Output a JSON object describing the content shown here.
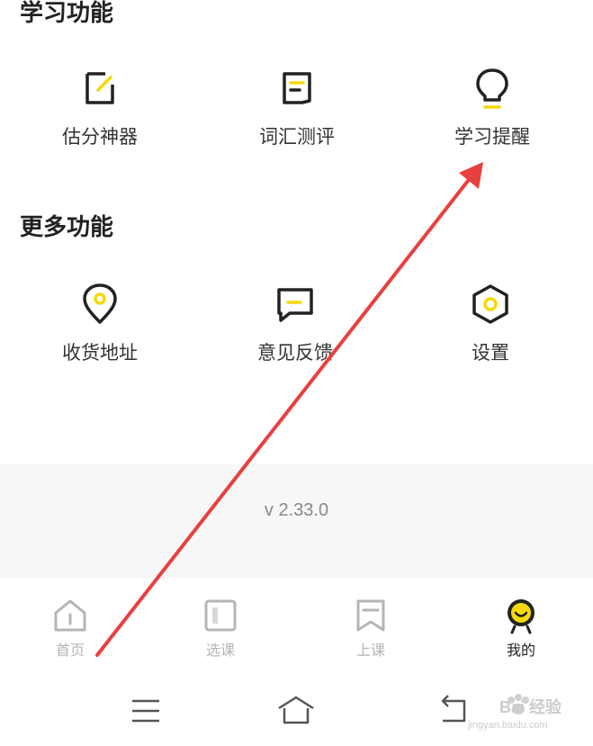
{
  "sections": {
    "study": {
      "title": "学习功能",
      "items": [
        {
          "label": "估分神器",
          "icon": "edit-icon"
        },
        {
          "label": "词汇测评",
          "icon": "document-icon"
        },
        {
          "label": "学习提醒",
          "icon": "lightbulb-icon"
        }
      ]
    },
    "more": {
      "title": "更多功能",
      "items": [
        {
          "label": "收货地址",
          "icon": "location-pin-icon"
        },
        {
          "label": "意见反馈",
          "icon": "chat-feedback-icon"
        },
        {
          "label": "设置",
          "icon": "settings-hex-icon"
        }
      ]
    }
  },
  "version": "v 2.33.0",
  "tabbar": {
    "tabs": [
      {
        "label": "首页",
        "icon": "home-icon",
        "active": false
      },
      {
        "label": "选课",
        "icon": "course-select-icon",
        "active": false
      },
      {
        "label": "上课",
        "icon": "bookmark-class-icon",
        "active": false
      },
      {
        "label": "我的",
        "icon": "smiley-avatar-icon",
        "active": true
      }
    ]
  },
  "system_nav": [
    "menu-icon",
    "home-outline-icon",
    "back-icon"
  ],
  "watermark": {
    "text": "Bai 经验",
    "url": "jingyan.baidu.com"
  },
  "colors": {
    "accent": "#f5d90a",
    "annotation_arrow": "#e84040",
    "inactive": "#b5b5b5"
  }
}
